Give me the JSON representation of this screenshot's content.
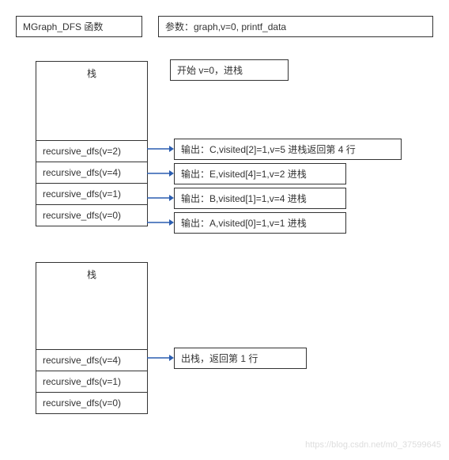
{
  "header": {
    "func": "MGraph_DFS 函数",
    "params": "参数：graph,v=0, printf_data"
  },
  "start": "开始 v=0，进栈",
  "stack1": {
    "title": "栈",
    "items": [
      "recursive_dfs(v=2)",
      "recursive_dfs(v=4)",
      "recursive_dfs(v=1)",
      "recursive_dfs(v=0)"
    ],
    "outputs": [
      "输出：C,visited[2]=1,v=5 进栈返回第 4 行",
      "输出：E,visited[4]=1,v=2 进栈",
      "输出：B,visited[1]=1,v=4 进栈",
      "输出：A,visited[0]=1,v=1 进栈"
    ]
  },
  "stack2": {
    "title": "栈",
    "items": [
      "recursive_dfs(v=4)",
      "recursive_dfs(v=1)",
      "recursive_dfs(v=0)"
    ],
    "outputs": [
      "出栈，返回第 1 行"
    ]
  },
  "watermark": "https://blog.csdn.net/m0_37599645"
}
